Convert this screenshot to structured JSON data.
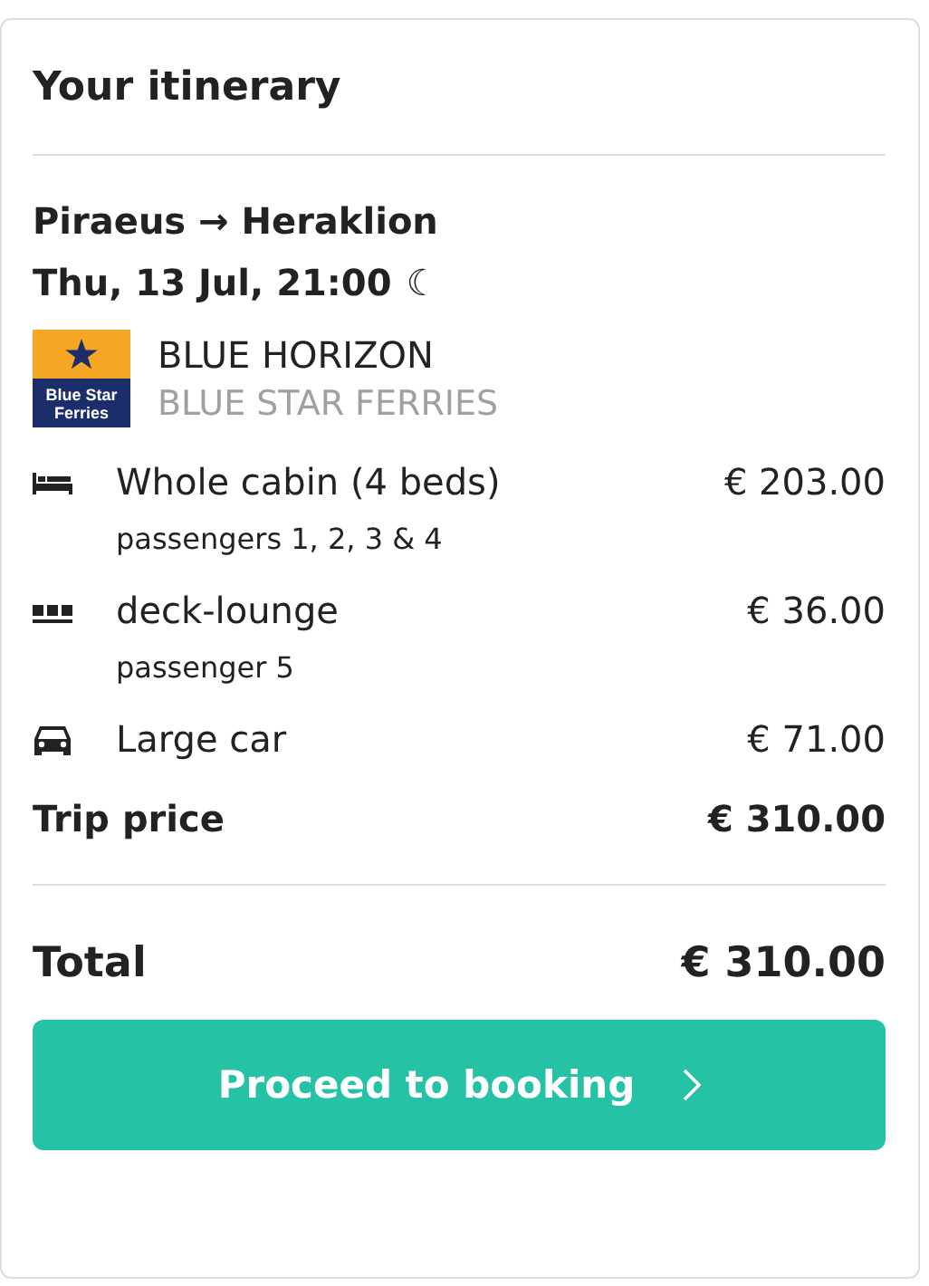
{
  "title": "Your itinerary",
  "trip": {
    "route": "Piraeus → Heraklion",
    "departure": "Thu, 13 Jul, 21:00",
    "night_symbol": "☾",
    "vessel": {
      "logo_text": "Blue Star Ferries",
      "name": "BLUE HORIZON",
      "operator": "BLUE STAR FERRIES"
    },
    "items": [
      {
        "kind": "cabin",
        "label": "Whole cabin (4 beds)",
        "detail": "passengers 1, 2, 3 & 4",
        "price": "€ 203.00"
      },
      {
        "kind": "seat",
        "label": "deck-lounge",
        "detail": "passenger 5",
        "price": "€ 36.00"
      },
      {
        "kind": "vehicle",
        "label": "Large car",
        "price": "€ 71.00"
      }
    ],
    "trip_price": {
      "label": "Trip price",
      "value": "€ 310.00"
    }
  },
  "total": {
    "label": "Total",
    "value": "€ 310.00"
  },
  "button": {
    "label": "Proceed to booking"
  }
}
